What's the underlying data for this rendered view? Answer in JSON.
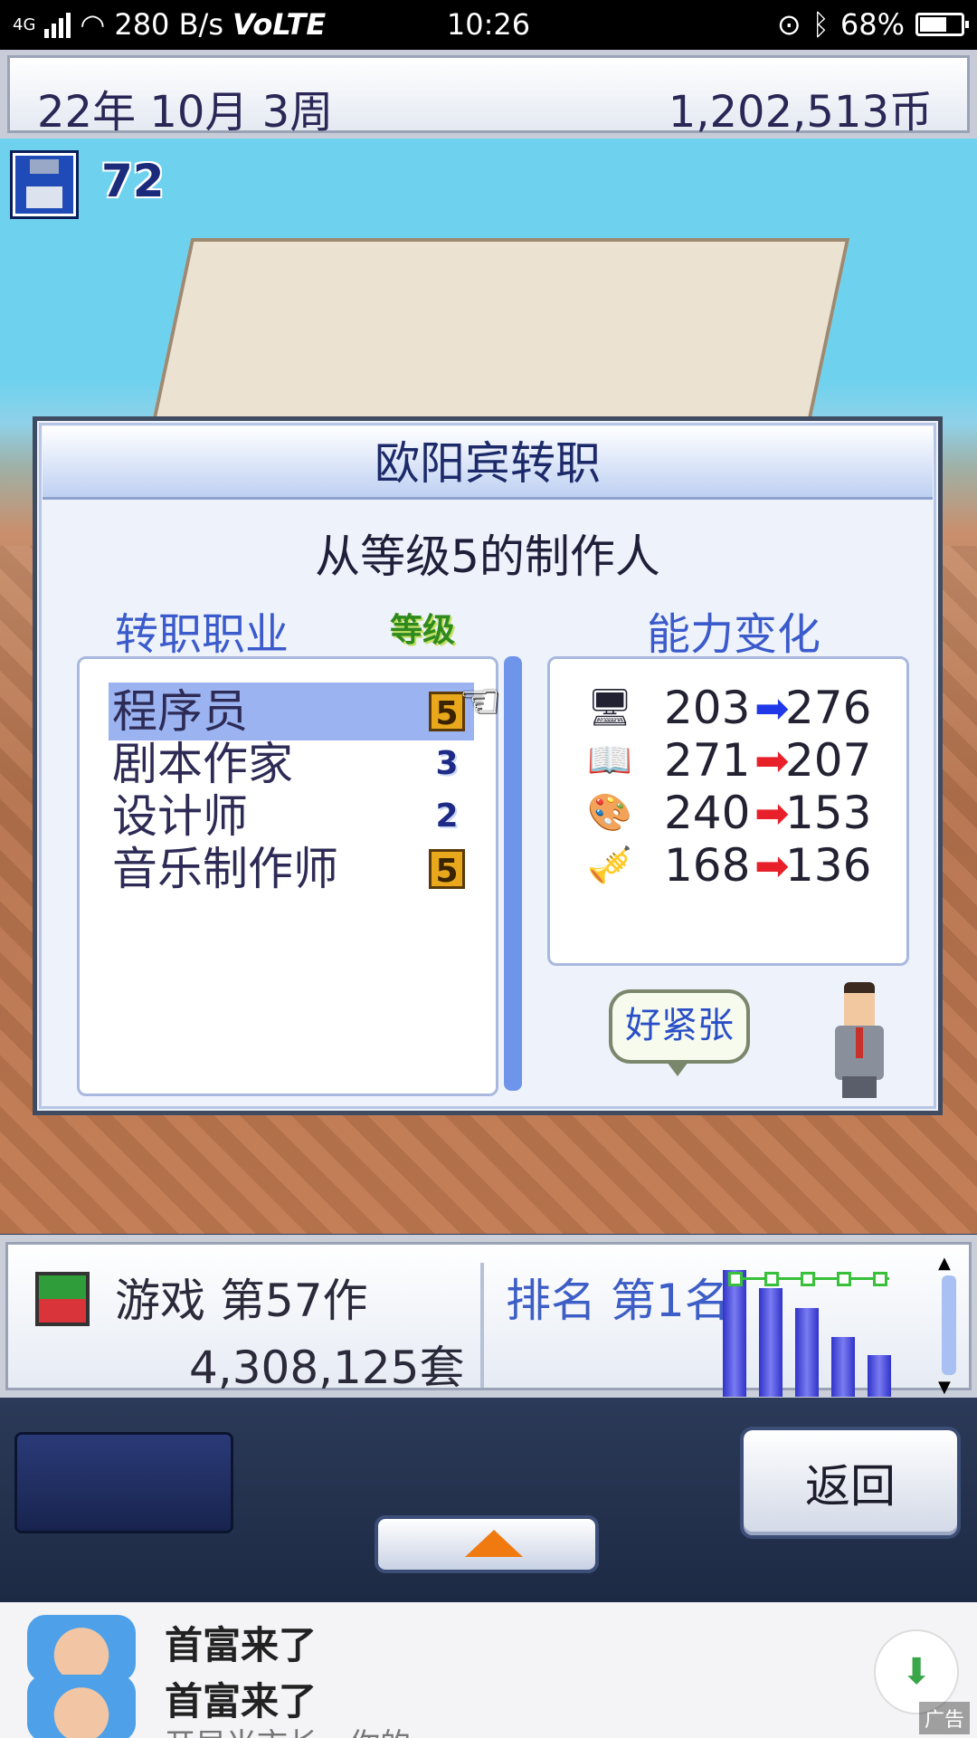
{
  "status_bar": {
    "network": "4G",
    "speed": "280 B/s",
    "volte": "VoLTE",
    "time": "10:26",
    "battery": "68%"
  },
  "header": {
    "date": "22年 10月 3周",
    "money": "1,202,513币"
  },
  "hud": {
    "disk_count": "72"
  },
  "dialog": {
    "title": "欧阳宾转职",
    "subtitle": "从等级5的制作人",
    "col_job": "转职职业",
    "col_level": "等级",
    "col_stats": "能力变化",
    "jobs": [
      {
        "name": "程序员",
        "level": "5",
        "selected": true
      },
      {
        "name": "剧本作家",
        "level": "3",
        "selected": false
      },
      {
        "name": "设计师",
        "level": "2",
        "selected": false
      },
      {
        "name": "音乐制作师",
        "level": "5",
        "selected": false
      }
    ],
    "stats": [
      {
        "icon": "computer-icon",
        "from": "203",
        "to": "276",
        "trend": "up"
      },
      {
        "icon": "book-icon",
        "from": "271",
        "to": "207",
        "trend": "down"
      },
      {
        "icon": "palette-icon",
        "from": "240",
        "to": "153",
        "trend": "down"
      },
      {
        "icon": "trumpet-icon",
        "from": "168",
        "to": "136",
        "trend": "down"
      }
    ],
    "speech": "好紧张"
  },
  "game_info": {
    "title": "游戏 第57作",
    "sales": "4,308,125套",
    "rank": "排名 第1名"
  },
  "controls": {
    "back_label": "返回"
  },
  "ad": {
    "name_1": "首富来了",
    "name_2": "首富来了",
    "desc": "开局当市长，你的..."
  },
  "colors": {
    "accent_blue": "#3b5bcc",
    "up_arrow": "#2038e8",
    "down_arrow": "#e8202a",
    "level_gold": "#e9a81c"
  }
}
